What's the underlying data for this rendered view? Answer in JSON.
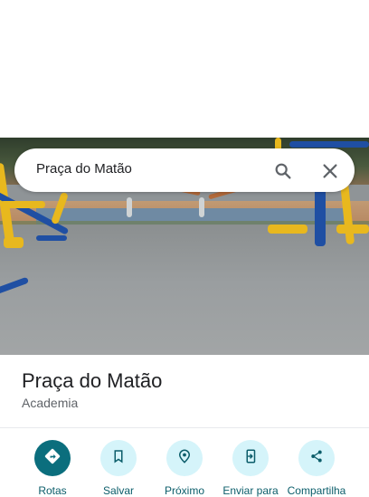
{
  "search": {
    "query": "Praça do Matão"
  },
  "place": {
    "name": "Praça do Matão",
    "category": "Academia"
  },
  "actions": [
    {
      "label": "Rotas",
      "icon": "directions-icon"
    },
    {
      "label": "Salvar",
      "icon": "bookmark-icon"
    },
    {
      "label": "Próximo",
      "icon": "nearby-icon"
    },
    {
      "label": "Enviar para",
      "icon": "send-to-device-icon"
    },
    {
      "label": "Compartilha",
      "icon": "share-icon"
    }
  ],
  "colors": {
    "accent": "#0b6e7d",
    "accent_light": "#d5f4fa",
    "label": "#0b5d6a"
  }
}
